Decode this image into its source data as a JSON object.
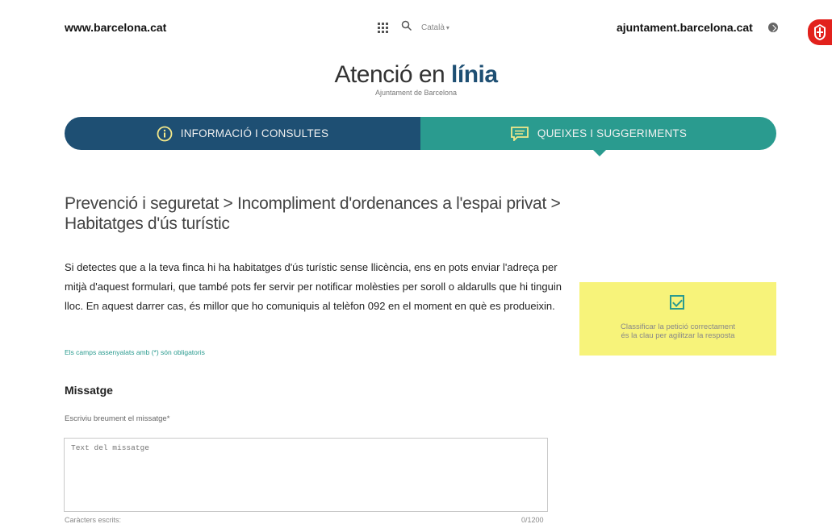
{
  "topbar": {
    "site_link": "www.barcelona.cat",
    "language": "Català",
    "ajuntament_link": "ajuntament.barcelona.cat"
  },
  "brand": {
    "title_main": "Atenció en ",
    "title_bold": "línia",
    "subtitle": "Ajuntament de Barcelona"
  },
  "tabs": [
    {
      "label": "INFORMACIÓ I CONSULTES"
    },
    {
      "label": "QUEIXES I SUGGERIMENTS"
    }
  ],
  "page": {
    "title_line1": "Prevenció i seguretat > Incompliment d'ordenances a l'espai privat >",
    "title_line2": "Habitatges d'ús turístic",
    "intro": "Si detectes que a la teva finca hi ha habitatges d'ús turístic sense llicència, ens en pots enviar l'adreça per mitjà d'aquest formulari, que també pots fer servir per notificar molèsties per soroll o aldarulls que hi tinguin lloc. En aquest darrer cas, és millor que ho comuniquis al telèfon 092 en el moment en què es produeixin.",
    "required_note": "Els camps assenyalats amb (*) són obligatoris"
  },
  "form": {
    "section_title": "Missatge",
    "field_label": "Escriviu breument el missatge*",
    "message_placeholder": "Text del missatge",
    "chars_label": "Caràcters escrits:",
    "chars_count": "0/1200"
  },
  "tip": {
    "line1": "Classificar la petició correctament",
    "line2": "és la clau per agilitzar la resposta"
  },
  "colors": {
    "navy": "#1e4f73",
    "teal": "#2a9b8f",
    "tip_yellow": "#f7f37a",
    "logo_red": "#e2211c"
  }
}
